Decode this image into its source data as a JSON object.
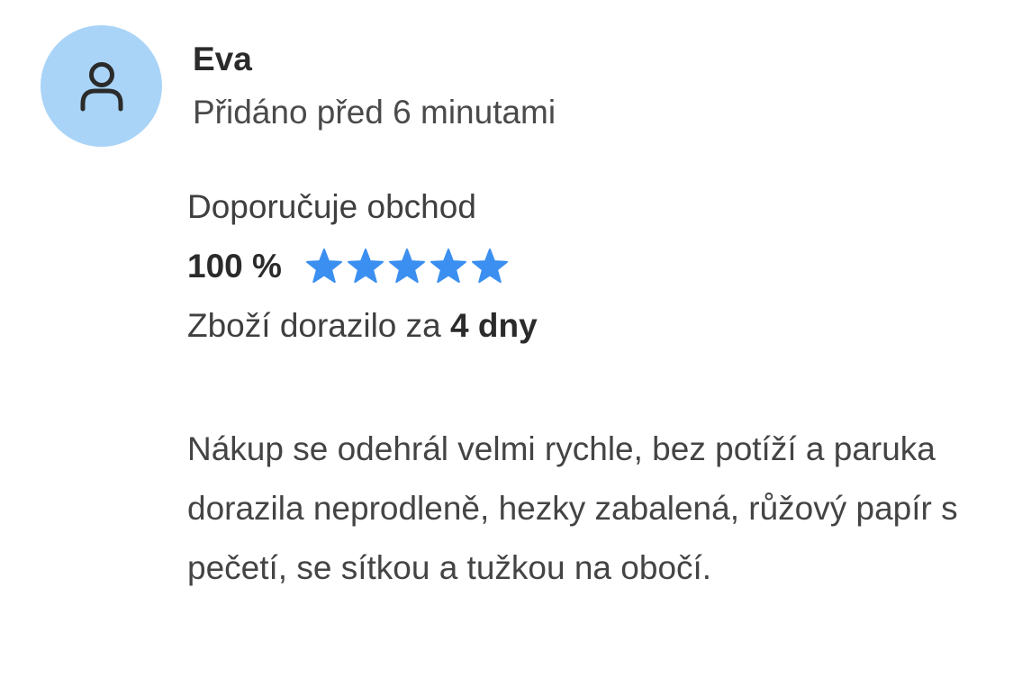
{
  "review": {
    "avatar_icon": "user-icon",
    "avatar_bg": "#a9d4f8",
    "author": "Eva",
    "added": "Přidáno před 6 minutami",
    "recommend_label": "Doporučuje obchod",
    "recommend_percent": "100 %",
    "rating": {
      "value": 5,
      "max": 5,
      "star_color": "#3b8ff0",
      "icon": "star-icon"
    },
    "delivery_prefix": "Zboží dorazilo za",
    "delivery_days": "4 dny",
    "text": "Nákup se odehrál velmi rychle, bez potíží a paruka dorazila neprodleně, hezky zabalená, růžový papír s pečetí, se sítkou a tužkou na obočí."
  }
}
